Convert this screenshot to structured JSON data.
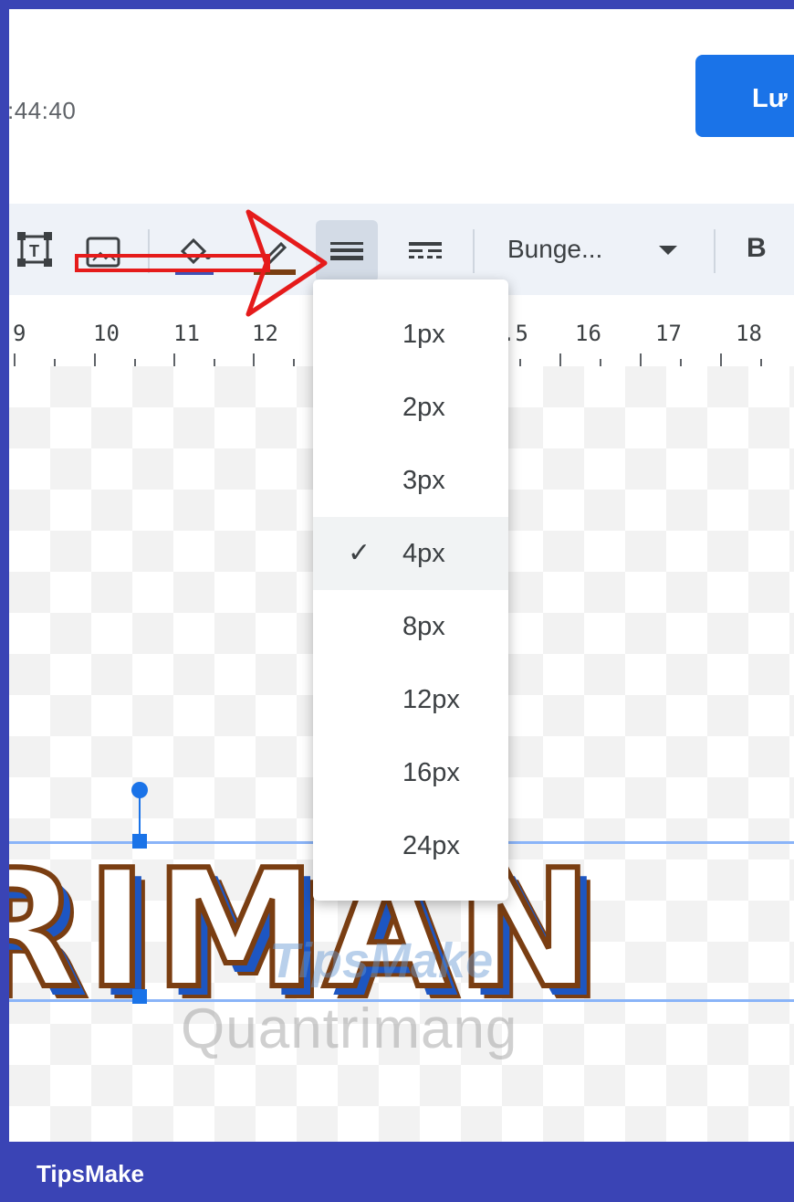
{
  "header": {
    "time_fragment": ":44:40",
    "save_label": "Lư"
  },
  "toolbar": {
    "font_name": "Bunge...",
    "bold_label": "B",
    "icons": [
      "text-box-icon",
      "image-frame-icon",
      "fill-color-icon",
      "pen-color-icon",
      "line-weight-icon",
      "line-dash-icon",
      "chevron-down-icon"
    ]
  },
  "ruler": {
    "numbers": [
      "9",
      "10",
      "11",
      "12",
      ".5",
      "16",
      "17",
      "18"
    ]
  },
  "line_weight_menu": {
    "options": [
      "1px",
      "2px",
      "3px",
      "4px",
      "8px",
      "12px",
      "16px",
      "24px"
    ],
    "selected": "4px",
    "check_glyph": "✓"
  },
  "canvas": {
    "wordart_text": "RIMAN"
  },
  "watermark": {
    "brand": "TipsMake",
    "site": "Quantrimang"
  },
  "footer": {
    "brand": "TipsMake"
  },
  "colors": {
    "accent": "#1a73e8",
    "frame": "#3a44b5",
    "annotation_red": "#e51b1b",
    "wordart_outline": "#7a3e12",
    "wordart_shadow": "#1d56c2"
  }
}
